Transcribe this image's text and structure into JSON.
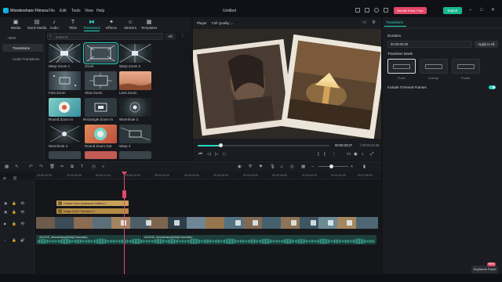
{
  "app": {
    "name": "Wondershare Filmora",
    "document_title": "Untitled",
    "menu": [
      "File",
      "Edit",
      "Tools",
      "View",
      "Help"
    ],
    "bundle_button": "Bundle Price: Free",
    "export_button": "Export"
  },
  "media_tabs": [
    {
      "label": "Media",
      "icon": "media-icon"
    },
    {
      "label": "Stock Media",
      "icon": "stock-media-icon"
    },
    {
      "label": "Audio",
      "icon": "audio-icon"
    },
    {
      "label": "Titles",
      "icon": "titles-icon"
    },
    {
      "label": "Transitions",
      "icon": "transitions-icon",
      "active": true
    },
    {
      "label": "Effects",
      "icon": "effects-icon"
    },
    {
      "label": "Stickers",
      "icon": "stickers-icon"
    },
    {
      "label": "Templates",
      "icon": "templates-icon"
    }
  ],
  "library_nav": {
    "mine": "Mine",
    "transitions": "Transitions",
    "audio_transitions": "Audio Transitions"
  },
  "search": {
    "placeholder": "zoom in",
    "filter": "All"
  },
  "transitions": [
    "Warp Zoom 1",
    "Zoom",
    "Warp Zoom 2",
    "Fast Zoom",
    "Slow Zoom",
    "Lens Zoom",
    "Round Zoom In",
    "Rectangle Zoom In",
    "Wormhole 2",
    "Wormhole 4",
    "Round Zoom Out",
    "Warp 3"
  ],
  "player": {
    "label": "Player",
    "quality": "Full Quality",
    "time_current": "00:00:23:27",
    "time_total": "/ 00:00:24:09",
    "progress": 0.17
  },
  "right_panel": {
    "tab": "Transitions",
    "duration_label": "Duration",
    "duration_value": "00:00:02:00",
    "apply_all": "Apply to All",
    "mode_label": "Transition Mode",
    "modes": [
      "Prefix",
      "Overlap",
      "Postfix"
    ],
    "trimmed_label": "Include Trimmed Frames",
    "trimmed_on": true
  },
  "timeline": {
    "ticks": [
      "00:00:00:00",
      "00:00:06:00",
      "00:00:12:00",
      "00:00:18:00",
      "00:00:24:00",
      "00:00:30:00",
      "00:00:36:00",
      "00:00:42:00",
      "00:00:48:00",
      "00:00:54:00",
      "00:01:00:00",
      "00:01:06:00"
    ],
    "effect_clip_1": "Outline Glow (Individual Outline) 1",
    "effect_clip_2": "Image Zoom Transition 3",
    "audio_clip_1": "ADVISE_Wonderland(Edit)(Cinematic)",
    "audio_clip_2": "ADVISE_Wonderland(Edit)(Cinematic)"
  },
  "help": {
    "label": "Keyframe Panel",
    "badge": "NEW"
  },
  "colors": {
    "accent": "#26d7c3",
    "export": "#16b98f",
    "playhead": "#e2496a",
    "bundle": "#e24866"
  }
}
